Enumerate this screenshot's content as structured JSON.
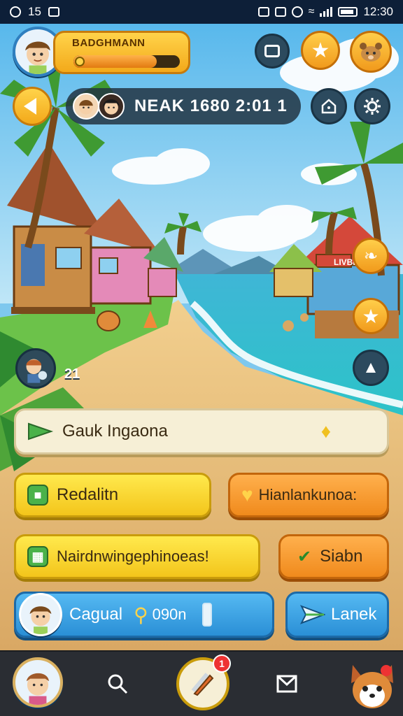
{
  "status_bar": {
    "left_text": "15",
    "time": "12:30"
  },
  "player": {
    "name": "BADGHMANN",
    "xp_fraction": 0.78
  },
  "info_bar": {
    "text": "NEAK 1680 2:01 1"
  },
  "scene": {
    "shop_sign": "LIVBER"
  },
  "side_chip": {
    "count": "21"
  },
  "actions": {
    "main": "Gauk Ingaona",
    "left_1": "Redalitn",
    "right_1": "Hianlankunoa:",
    "left_2": "Nairdnwingephinoeas!",
    "right_2": "Siabn",
    "profile_btn": "Cagual",
    "profile_value": "090n",
    "go_btn": "Lanek"
  },
  "bottom_nav": {
    "badge": "1"
  },
  "colors": {
    "accent_yellow": "#f3c51b",
    "accent_orange": "#f08a1c",
    "accent_blue": "#2a8fd6",
    "nav_bg": "#2a2d33"
  },
  "icons": [
    "chat-icon",
    "star-icon",
    "pet-icon",
    "back-arrow-icon",
    "house-icon",
    "settings-gear-icon",
    "bird-icon",
    "star-badge-icon",
    "arrow-up-icon",
    "play-arrow-icon",
    "bell-icon",
    "shield-icon",
    "heart-icon",
    "box-icon",
    "check-icon",
    "key-icon",
    "bottle-icon",
    "send-icon",
    "search-icon",
    "mail-icon",
    "dog-icon"
  ]
}
